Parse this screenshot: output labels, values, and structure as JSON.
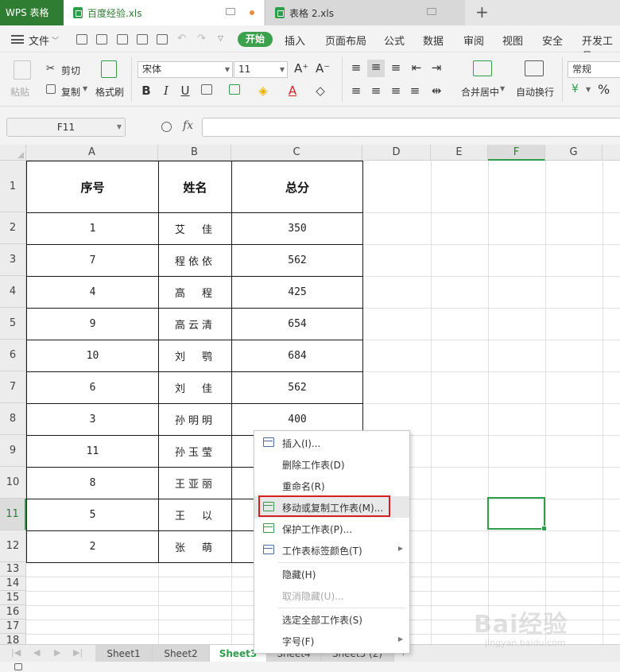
{
  "titlebar": {
    "app_name": "WPS 表格",
    "tabs": [
      {
        "name": "百度经验.xls",
        "active": true,
        "unsaved": true
      },
      {
        "name": "表格 2.xls",
        "active": false
      }
    ],
    "new_tab": "+"
  },
  "menubar": {
    "file": "文件",
    "items": [
      "开始",
      "插入",
      "页面布局",
      "公式",
      "数据",
      "审阅",
      "视图",
      "安全",
      "开发工具"
    ],
    "active": "开始"
  },
  "ribbon": {
    "paste": "粘贴",
    "cut": "剪切",
    "copy": "复制",
    "format_painter": "格式刷",
    "font_name": "宋体",
    "font_size": "11",
    "grow_font": "A⁺",
    "shrink_font": "A⁻",
    "bold": "B",
    "italic": "I",
    "underline": "U",
    "merge_center": "合并居中",
    "wrap_text": "自动换行",
    "number_format": "常规",
    "currency": "¥",
    "percent": "%"
  },
  "formula_bar": {
    "name_box": "F11",
    "fx": "fx",
    "content": ""
  },
  "grid": {
    "columns": [
      "A",
      "B",
      "C",
      "D",
      "E",
      "F",
      "G"
    ],
    "active_column": "F",
    "rows": [
      "1",
      "2",
      "3",
      "4",
      "5",
      "6",
      "7",
      "8",
      "9",
      "10",
      "11",
      "12",
      "13",
      "14",
      "15",
      "16",
      "17",
      "18"
    ],
    "active_row": "11",
    "table_header": [
      "序号",
      "姓名",
      "总分"
    ],
    "table_rows": [
      [
        "1",
        "艾　佳",
        "350"
      ],
      [
        "7",
        "程依依",
        "562"
      ],
      [
        "4",
        "高　程",
        "425"
      ],
      [
        "9",
        "高云清",
        "654"
      ],
      [
        "10",
        "刘　鹗",
        "684"
      ],
      [
        "6",
        "刘　佳",
        "562"
      ],
      [
        "3",
        "孙明明",
        "400"
      ],
      [
        "11",
        "孙玉莹",
        ""
      ],
      [
        "8",
        "王亚丽",
        ""
      ],
      [
        "5",
        "王　以",
        ""
      ],
      [
        "2",
        "张　萌",
        ""
      ]
    ]
  },
  "context_menu": {
    "items": [
      {
        "label": "插入(I)...",
        "icon": "insert-sheet-icon"
      },
      {
        "label": "删除工作表(D)"
      },
      {
        "label": "重命名(R)"
      },
      {
        "label": "移动或复制工作表(M)...",
        "icon": "move-copy-sheet-icon",
        "highlighted": true
      },
      {
        "label": "保护工作表(P)...",
        "icon": "protect-sheet-icon"
      },
      {
        "label": "工作表标签颜色(T)",
        "icon": "tab-color-icon",
        "submenu": true
      },
      {
        "label": "隐藏(H)"
      },
      {
        "label": "取消隐藏(U)...",
        "disabled": true
      },
      {
        "label": "选定全部工作表(S)"
      },
      {
        "label": "字号(F)",
        "submenu": true
      }
    ]
  },
  "sheet_tabs": {
    "tabs": [
      "Sheet1",
      "Sheet2",
      "Sheet3",
      "Sheet4",
      "Sheet5 (2)"
    ],
    "active": "Sheet3",
    "add": "+"
  },
  "watermark": {
    "main": "Bai经验",
    "sub": "jingyan.baidu.com"
  },
  "colors": {
    "accent": "#2e9e4a",
    "app_tab": "#2e7d32",
    "highlight_box": "#d32020"
  }
}
